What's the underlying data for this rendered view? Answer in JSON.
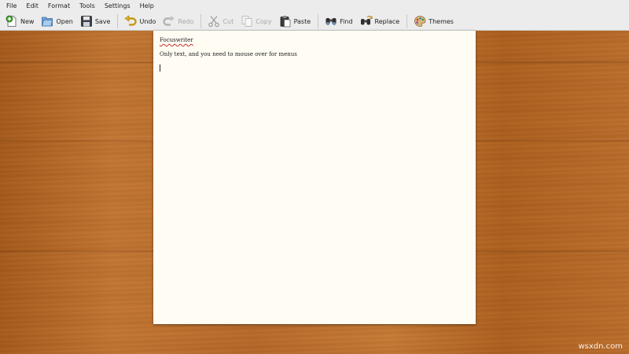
{
  "menubar": {
    "items": [
      "File",
      "Edit",
      "Format",
      "Tools",
      "Settings",
      "Help"
    ]
  },
  "toolbar": {
    "new_label": "New",
    "open_label": "Open",
    "save_label": "Save",
    "undo_label": "Undo",
    "redo_label": "Redo",
    "cut_label": "Cut",
    "copy_label": "Copy",
    "paste_label": "Paste",
    "find_label": "Find",
    "replace_label": "Replace",
    "themes_label": "Themes",
    "disabled": [
      "redo",
      "cut",
      "copy"
    ]
  },
  "document": {
    "title": "Focuswriter",
    "line1": "Only text, and you need to mouse over for menus"
  },
  "watermark": "wsxdn.com",
  "colors": {
    "chrome": "#ececec",
    "page": "#fffcf3",
    "desk": "#b06422",
    "spellcheck": "#c03030"
  }
}
